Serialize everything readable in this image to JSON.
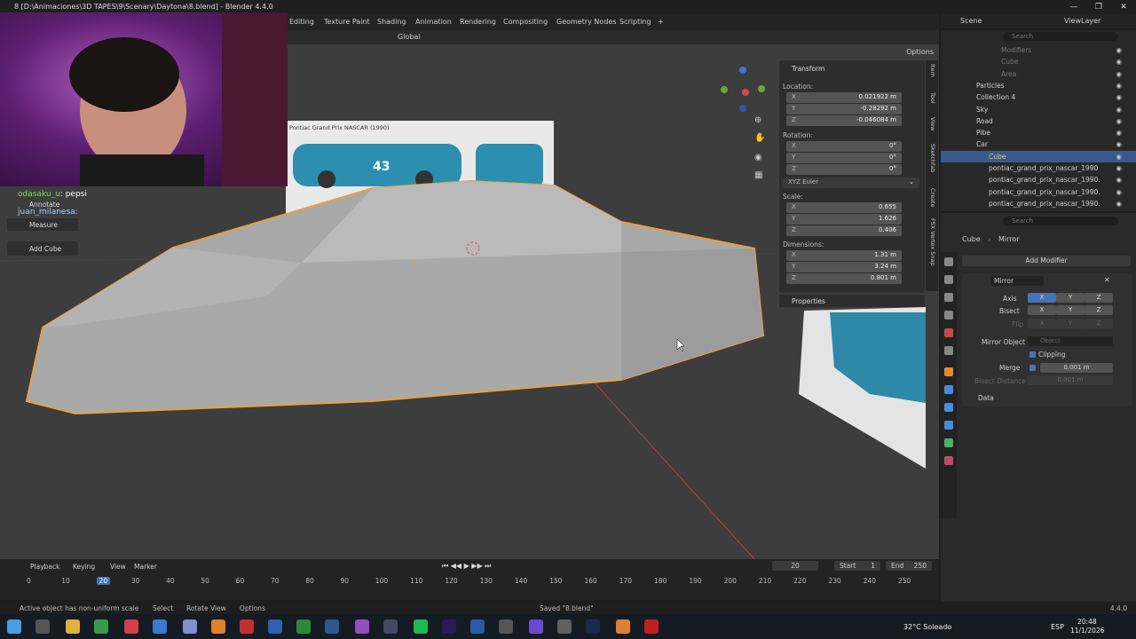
{
  "window": {
    "title": "8 [D:\\Animaciones\\3D TAPES\\9\\Scenary\\Daytona\\8.blend] - Blender 4.4.0"
  },
  "workspaces": [
    "Editing",
    "Texture Paint",
    "Shading",
    "Animation",
    "Rendering",
    "Compositing",
    "Geometry Nodes",
    "Scripting",
    "+"
  ],
  "scene": {
    "label": "Scene",
    "view_layer": "ViewLayer"
  },
  "viewport": {
    "transform_orientation": "Global",
    "options_label": "Options",
    "ref_image_title": "Pontiac Grand Prix NASCAR (1990)",
    "ref_car_number": "43",
    "chat": [
      {
        "user": "odasaku_u",
        "message": "pepsi"
      },
      {
        "user": "juan_milanesa",
        "message": ""
      }
    ],
    "toolbar": [
      "Annotate",
      "Measure",
      "Add Cube"
    ]
  },
  "npanel": {
    "header": "Transform",
    "location_label": "Location:",
    "location": {
      "x": "0.021922 m",
      "y": "-0.28292 m",
      "z": "-0.046084 m"
    },
    "rotation_label": "Rotation:",
    "rotation": {
      "x": "0°",
      "y": "0°",
      "z": "0°"
    },
    "rotation_mode": "XYZ Euler",
    "scale_label": "Scale:",
    "scale": {
      "x": "0.655",
      "y": "1.626",
      "z": "0.406"
    },
    "dimensions_label": "Dimensions:",
    "dimensions": {
      "x": "1.31 m",
      "y": "3.24 m",
      "z": "0.801 m"
    },
    "properties_label": "Properties",
    "axis_x": "X",
    "axis_y": "Y",
    "axis_z": "Z",
    "tabs": [
      "Item",
      "Tool",
      "View",
      "Sketchfab",
      "Create",
      "FSX Vertex Snap"
    ]
  },
  "outliner": {
    "search_placeholder": "Search",
    "rows": [
      {
        "label": "Modifiers",
        "indent": 4,
        "dim": true
      },
      {
        "label": "Cube",
        "indent": 4,
        "dim": true
      },
      {
        "label": "Area",
        "indent": 4,
        "dim": true
      },
      {
        "label": "Particles",
        "indent": 2
      },
      {
        "label": "Collection 4",
        "indent": 2
      },
      {
        "label": "Sky",
        "indent": 2
      },
      {
        "label": "Road",
        "indent": 2
      },
      {
        "label": "Pibe",
        "indent": 2
      },
      {
        "label": "Car",
        "indent": 2
      },
      {
        "label": "Cube",
        "indent": 3,
        "selected": true
      },
      {
        "label": "pontiac_grand_prix_nascar_1990",
        "indent": 3
      },
      {
        "label": "pontiac_grand_prix_nascar_1990.",
        "indent": 3
      },
      {
        "label": "pontiac_grand_prix_nascar_1990.",
        "indent": 3
      },
      {
        "label": "pontiac_grand_prix_nascar_1990.",
        "indent": 3
      }
    ]
  },
  "properties": {
    "search_placeholder": "Search",
    "breadcrumb_object": "Cube",
    "breadcrumb_modifier": "Mirror",
    "add_modifier": "Add Modifier",
    "modifier_name": "Mirror",
    "axis_label": "Axis",
    "bisect_label": "Bisect",
    "flip_label": "Flip",
    "mirror_object_label": "Mirror Object",
    "mirror_object_placeholder": "Object",
    "clipping_label": "Clipping",
    "merge_label": "Merge",
    "merge_value": "0.001 m",
    "bisect_distance_label": "Bisect Distance",
    "bisect_distance_value": "0.001 m",
    "data_label": "Data",
    "x": "X",
    "y": "Y",
    "z": "Z"
  },
  "timeline": {
    "menus": [
      "Playback",
      "Keying",
      "View",
      "Marker"
    ],
    "current_frame": "20",
    "start_label": "Start",
    "start": "1",
    "end_label": "End",
    "end": "250",
    "ticks": [
      "0",
      "10",
      "20",
      "30",
      "40",
      "50",
      "60",
      "70",
      "80",
      "90",
      "100",
      "110",
      "120",
      "130",
      "140",
      "150",
      "160",
      "170",
      "180",
      "190",
      "200",
      "210",
      "220",
      "230",
      "240",
      "250"
    ],
    "current_tick": 20
  },
  "statusbar": {
    "warning": "Active object has non-uniform scale",
    "select": "Select",
    "rotate": "Rotate View",
    "options": "Options",
    "saved": "Saved \"8.blend\"",
    "version": "4.4.0"
  },
  "taskbar": {
    "weather": "32°C  Soleado",
    "lang": "ESP",
    "time": "20:48",
    "date": "11/1/2026"
  },
  "colors": {
    "selection_outline": "#e8a040",
    "accent": "#4772b3",
    "outliner_selected": "#3b5a8c"
  }
}
